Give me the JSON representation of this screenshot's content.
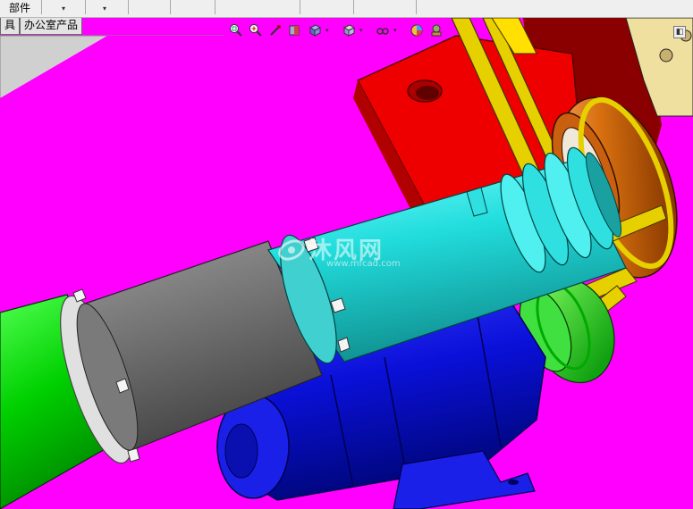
{
  "toolbar": {
    "component_label": "部件",
    "dropdown_arrow": "▾"
  },
  "tabs": [
    {
      "label": "具"
    },
    {
      "label": "办公室产品"
    }
  ],
  "heads_up_toolbar": {
    "icons": [
      "zoom-to-fit-icon",
      "zoom-area-icon",
      "previous-view-icon",
      "section-view-icon",
      "view-orientation-icon",
      "display-style-icon",
      "hide-show-items-icon",
      "edit-appearance-icon",
      "apply-scene-icon"
    ],
    "dropdown_arrow": "▾"
  },
  "corner_button": {
    "glyph": "◧"
  },
  "watermark": {
    "text": "沐风网",
    "url": "www.mfcad.com"
  },
  "colors": {
    "background": "#ff00ff",
    "frame_red": "#ee0000",
    "belt_yellow": "#e6c800",
    "cylinder_green": "#00dd00",
    "cylinder_gray": "#777777",
    "cylinder_cyan": "#22dddd",
    "motor_blue": "#0a10d8",
    "pulley_orange": "#d06800"
  }
}
